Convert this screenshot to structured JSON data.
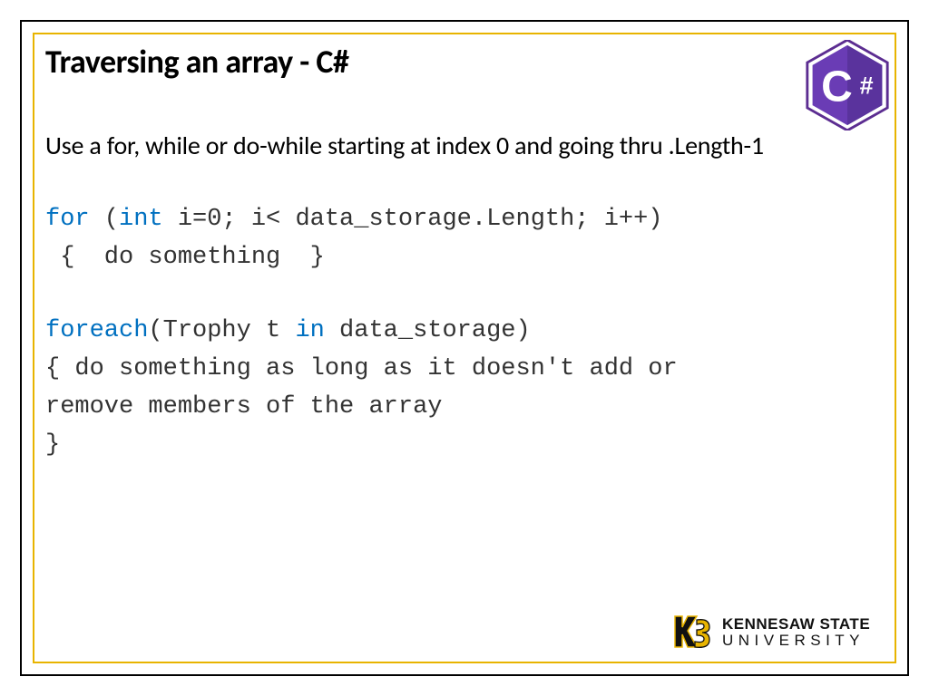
{
  "title": "Traversing an array - C#",
  "subtitle": "Use a for, while or do-while starting at index 0 and going thru .Length-1",
  "code1": {
    "kw_for": "for",
    "open_paren": " (",
    "kw_int": "int",
    "rest_line1": " i=0; i< data_storage.Length; i++)",
    "line2": " {  do something  }"
  },
  "code2": {
    "kw_foreach": "foreach",
    "open": "(Trophy t ",
    "kw_in": "in",
    "rest_line1": " data_storage)",
    "line2": "{  do something as long as it doesn't add or",
    "line3": " remove members of the array",
    "line4": "}"
  },
  "logo": {
    "csharp_letter": "C",
    "csharp_hash": "#",
    "ksu_top": "KENNESAW STATE",
    "ksu_bot": "UNIVERSITY"
  }
}
